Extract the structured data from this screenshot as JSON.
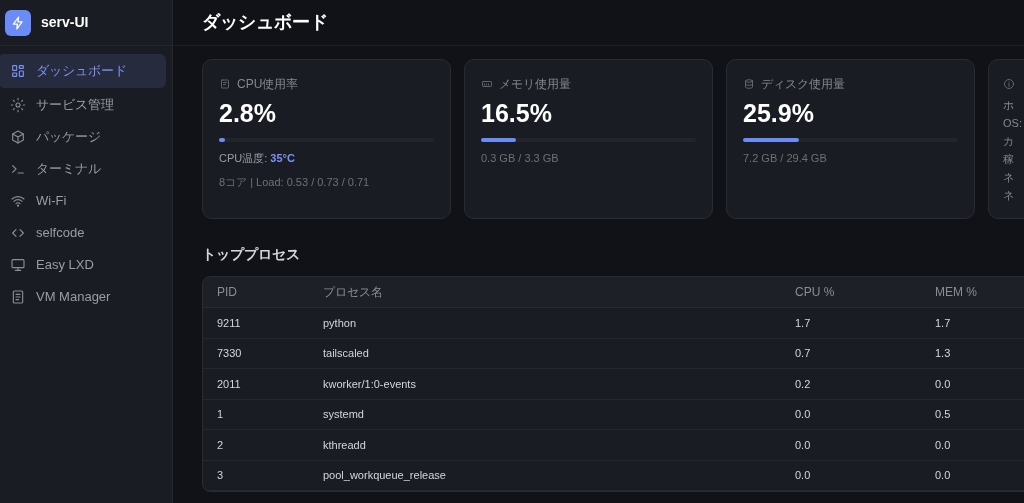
{
  "app": {
    "name": "serv-UI"
  },
  "sidebar": {
    "items": [
      {
        "label": "ダッシュボード",
        "selected": true
      },
      {
        "label": "サービス管理",
        "selected": false
      },
      {
        "label": "パッケージ",
        "selected": false
      },
      {
        "label": "ターミナル",
        "selected": false
      },
      {
        "label": "Wi-Fi",
        "selected": false
      },
      {
        "label": "selfcode",
        "selected": false
      },
      {
        "label": "Easy LXD",
        "selected": false
      },
      {
        "label": "VM Manager",
        "selected": false
      }
    ]
  },
  "page_title": "ダッシュボード",
  "cards": [
    {
      "kind": "meter",
      "title": "CPU使用率",
      "value": "2.8%",
      "level": 0.028,
      "details": [
        {
          "kind": "temp",
          "label": "CPU温度: ",
          "value": "35°C"
        },
        {
          "kind": "plain",
          "text": "8コア | Load: 0.53 / 0.73 / 0.71"
        }
      ]
    },
    {
      "kind": "meter",
      "title": "メモリ使用量",
      "value": "16.5%",
      "level": 0.165,
      "details": [
        {
          "kind": "plain",
          "text": "0.3 GB / 3.3 GB"
        }
      ]
    },
    {
      "kind": "meter",
      "title": "ディスク使用量",
      "value": "25.9%",
      "level": 0.259,
      "details": [
        {
          "kind": "plain",
          "text": "7.2 GB / 29.4 GB"
        }
      ]
    },
    {
      "kind": "info",
      "lines": [
        "ホ",
        "OS:",
        "カ",
        "稼",
        "ネ",
        "ネ"
      ]
    }
  ],
  "processes": {
    "title": "トッププロセス",
    "columns": [
      "PID",
      "プロセス名",
      "CPU %",
      "MEM %"
    ],
    "rows": [
      [
        "9211",
        "python",
        "1.7",
        "1.7"
      ],
      [
        "7330",
        "tailscaled",
        "0.7",
        "1.3"
      ],
      [
        "2011",
        "kworker/1:0-events",
        "0.2",
        "0.0"
      ],
      [
        "1",
        "systemd",
        "0.0",
        "0.5"
      ],
      [
        "2",
        "kthreadd",
        "0.0",
        "0.0"
      ],
      [
        "3",
        "pool_workqueue_release",
        "0.0",
        "0.0"
      ]
    ]
  }
}
